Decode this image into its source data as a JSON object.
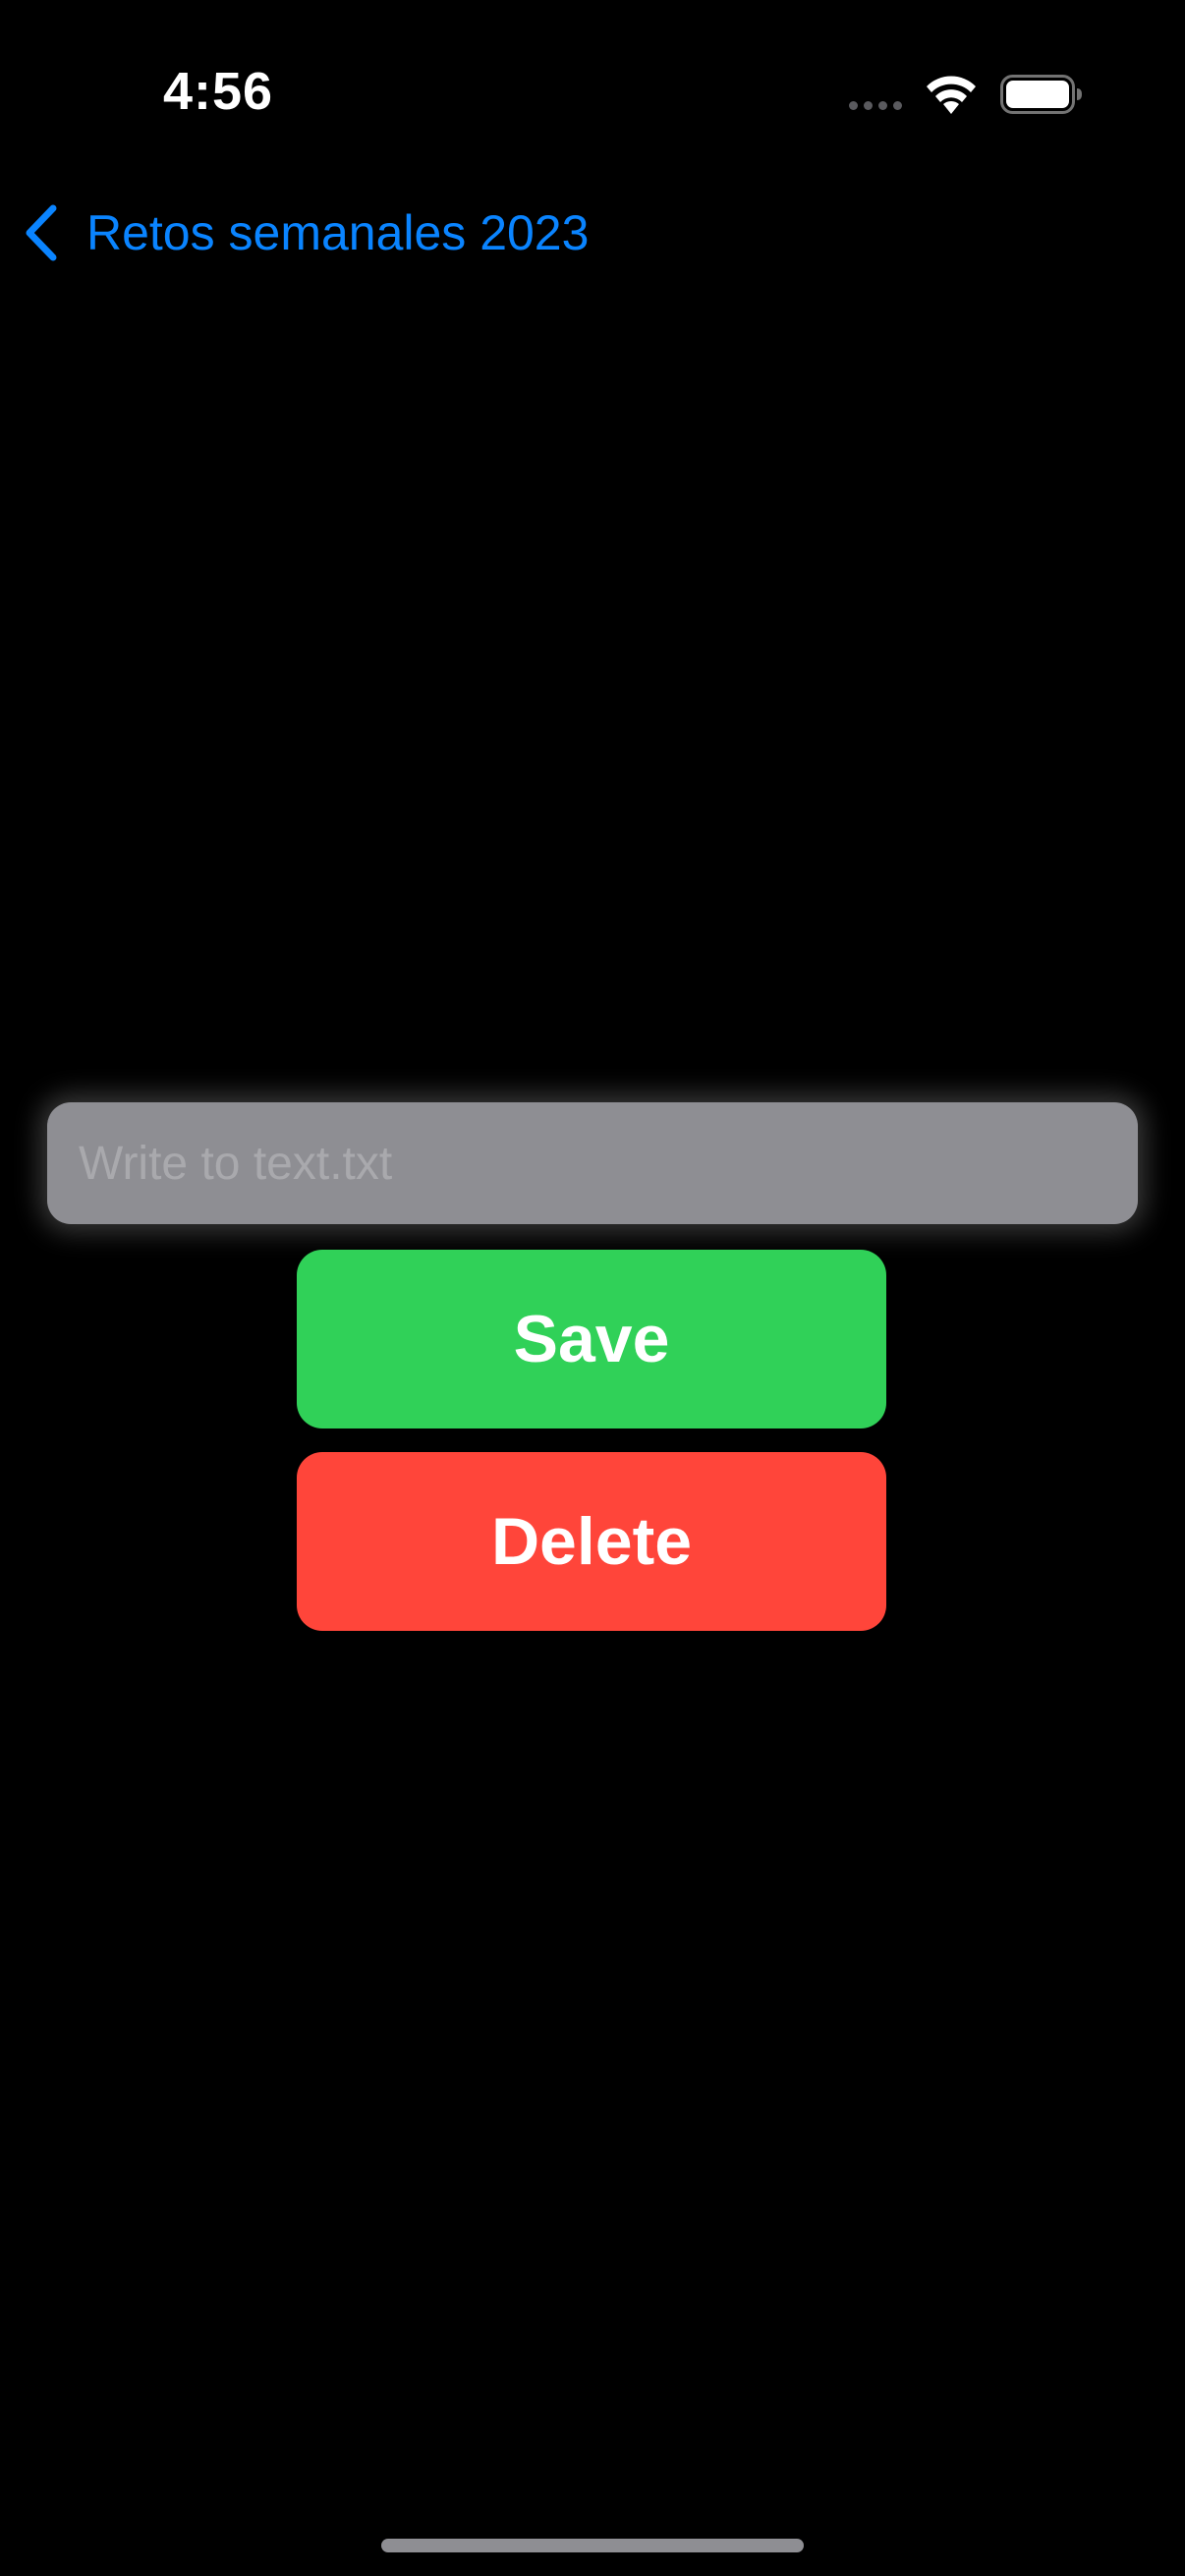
{
  "status_bar": {
    "time": "4:56",
    "icons": [
      "signal-dots-icon",
      "wifi-icon",
      "battery-icon"
    ]
  },
  "nav": {
    "back_icon": "chevron-left-icon",
    "back_label": "Retos semanales 2023"
  },
  "form": {
    "text_field": {
      "placeholder": "Write to text.txt",
      "value": ""
    },
    "save_label": "Save",
    "delete_label": "Delete"
  },
  "colors": {
    "background": "#000000",
    "accent": "#0a84ff",
    "save": "#30d158",
    "delete": "#ff453a",
    "field": "#8e8e93"
  }
}
